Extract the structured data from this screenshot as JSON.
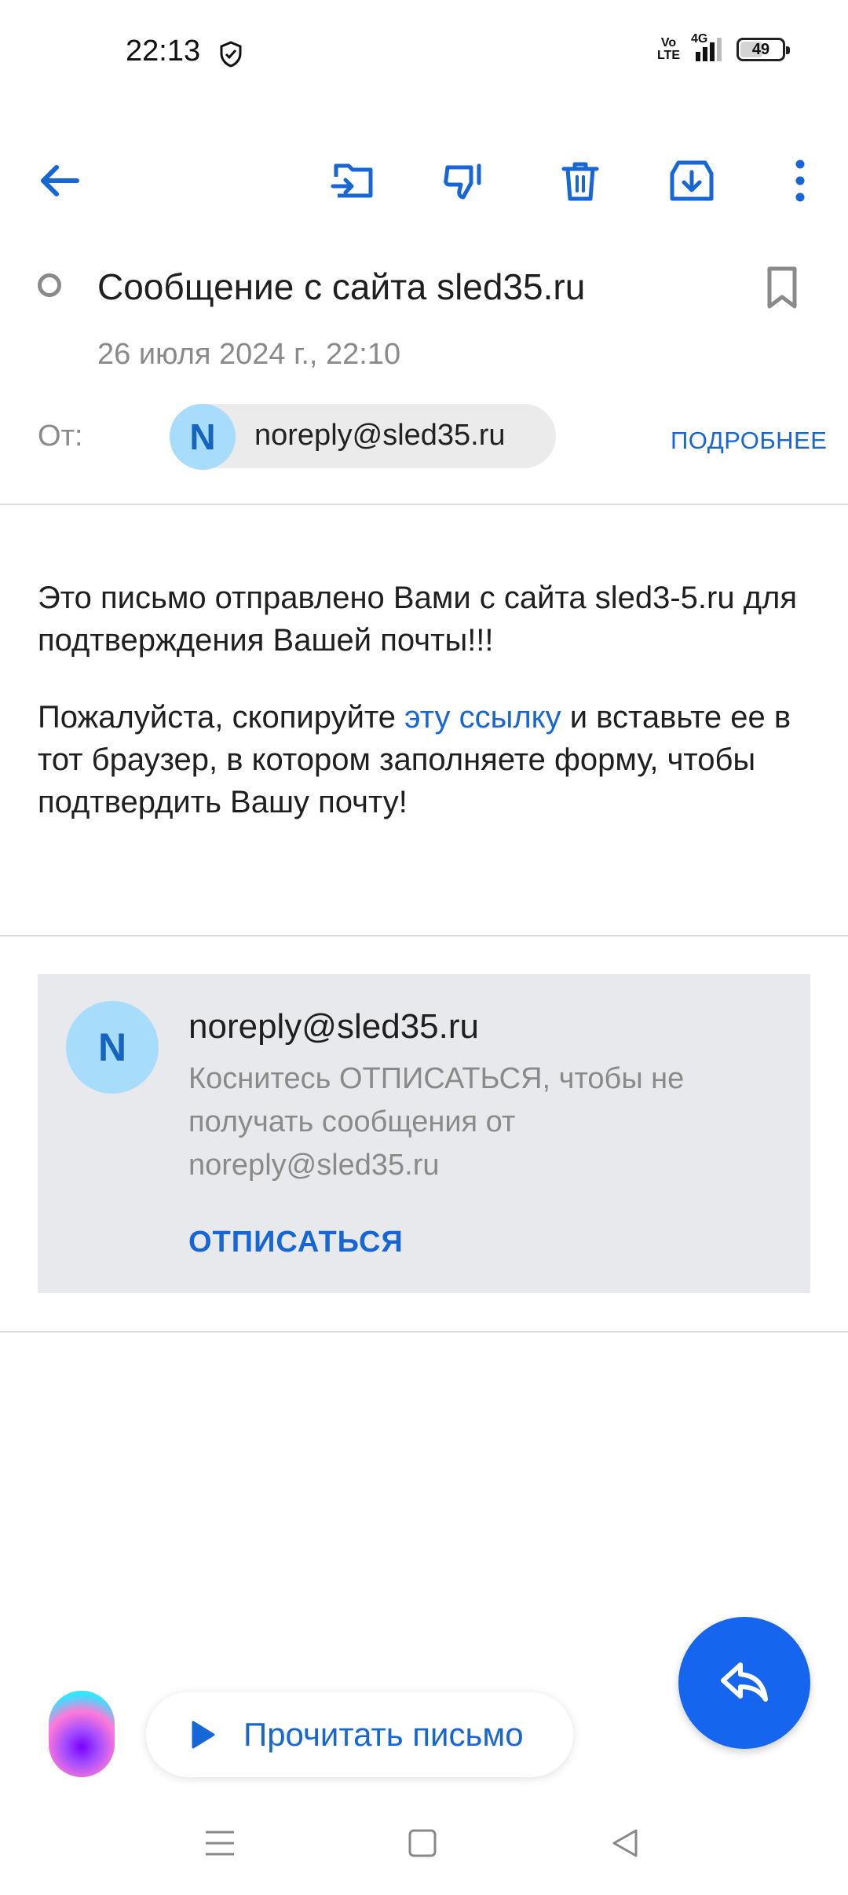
{
  "status_bar": {
    "time": "22:13",
    "volte_top": "Vo",
    "volte_bottom": "LTE",
    "network": "4G",
    "battery": "49"
  },
  "toolbar": {
    "icons": [
      "back-arrow-icon",
      "move-to-folder-icon",
      "spam-icon",
      "delete-icon",
      "archive-icon",
      "more-options-icon"
    ],
    "accent_color": "#1766d6"
  },
  "message": {
    "subject": "Сообщение с сайта sled35.ru",
    "date": "26 июля 2024 г., 22:10",
    "from_label": "От:",
    "sender_initial": "N",
    "sender_email": "noreply@sled35.ru",
    "details_label": "ПОДРОБНЕЕ",
    "body_p1": "Это письмо отправлено Вами с сайта sled3-5.ru для подтверждения Вашей почты!!!",
    "body_p2_before": "Пожалуйста, скопируйте ",
    "body_p2_link": "эту ссылку",
    "body_p2_after": " и вставьте ее в тот браузер, в котором заполняете форму, чтобы подтвердить Вашу почту!"
  },
  "unsubscribe_card": {
    "initial": "N",
    "email": "noreply@sled35.ru",
    "description": "Коснитесь ОТПИСАТЬСЯ, чтобы не получать сообщения от noreply@sled35.ru",
    "action": "ОТПИСАТЬСЯ"
  },
  "read_aloud": {
    "label": "Прочитать письмо"
  },
  "fab": {
    "icon": "reply-icon",
    "color": "#1565ee"
  },
  "nav": {
    "icons": [
      "menu-icon",
      "home-icon",
      "back-icon"
    ]
  }
}
